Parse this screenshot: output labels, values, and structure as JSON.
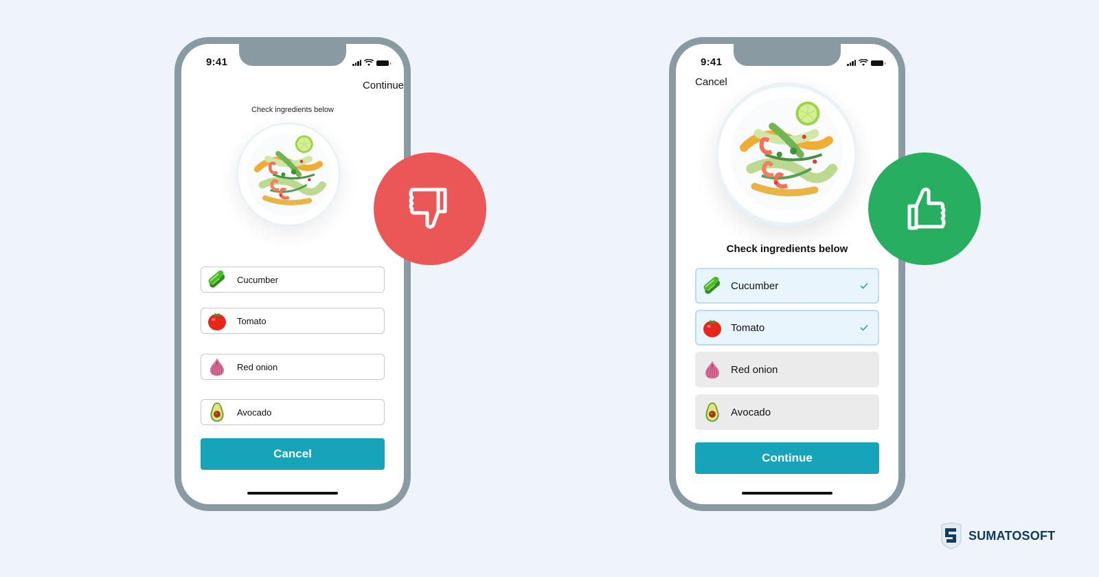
{
  "colors": {
    "background": "#eef4f9",
    "phone_frame": "#8a9aa3",
    "primary_button": "#17a3b8",
    "bad": "#eb5757",
    "good": "#27ae60",
    "checked_item_bg": "#e8f5fd",
    "unchecked_item_bg": "#ebebeb",
    "brand": "#0d3b66"
  },
  "left_phone": {
    "status_time": "9:41",
    "nav_action": "Continue",
    "heading": "Check ingredients below",
    "image": "salad-plate",
    "ingredients": [
      {
        "label": "Cucumber",
        "icon": "cucumber-icon"
      },
      {
        "label": "Tomato",
        "icon": "tomato-icon"
      },
      {
        "label": "Red onion",
        "icon": "red-onion-icon"
      },
      {
        "label": "Avocado",
        "icon": "avocado-icon"
      }
    ],
    "primary_button": "Cancel",
    "verdict": "thumbs-down-icon"
  },
  "right_phone": {
    "status_time": "9:41",
    "nav_action": "Cancel",
    "heading": "Check ingredients below",
    "image": "salad-plate",
    "ingredients": [
      {
        "label": "Cucumber",
        "icon": "cucumber-icon",
        "checked": true
      },
      {
        "label": "Tomato",
        "icon": "tomato-icon",
        "checked": true
      },
      {
        "label": "Red onion",
        "icon": "red-onion-icon",
        "checked": false
      },
      {
        "label": "Avocado",
        "icon": "avocado-icon",
        "checked": false
      }
    ],
    "primary_button": "Continue",
    "verdict": "thumbs-up-icon"
  },
  "brand": {
    "name": "SUMATOSOFT",
    "logo": "sumatosoft-logo-icon"
  }
}
